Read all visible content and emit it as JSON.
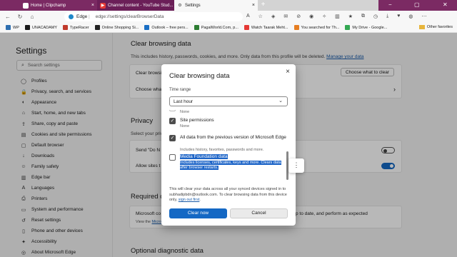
{
  "tabs": [
    {
      "title": "Home | Clipchamp",
      "close": "×"
    },
    {
      "title": "Channel content - YouTube Stud...",
      "close": "×"
    },
    {
      "title": "Settings",
      "close": "×"
    }
  ],
  "new_tab": "+",
  "address": {
    "host": "Edge",
    "separator": "|",
    "path": "edge://settings/clearBrowserData"
  },
  "favorites": [
    {
      "label": "WP",
      "color": "#2f6fb0"
    },
    {
      "label": "UNACADAMY",
      "color": "#1b1b1b"
    },
    {
      "label": "TypeRacer",
      "color": "#c0392b"
    },
    {
      "label": "Online Shopping Si...",
      "color": "#222222"
    },
    {
      "label": "Outlook – free pers...",
      "color": "#1a6fc4"
    },
    {
      "label": "PagalWorld.Com, p...",
      "color": "#2d7d32"
    },
    {
      "label": "Watch Taarak Meht...",
      "color": "#e53935"
    },
    {
      "label": "You searched for Th...",
      "color": "#e67e22"
    },
    {
      "label": "My Drive - Google...",
      "color": "#34a853"
    }
  ],
  "other_favorites": "Other favorites",
  "sidebar": {
    "title": "Settings",
    "search_placeholder": "Search settings",
    "items": [
      {
        "label": "Profiles",
        "icon": "◯"
      },
      {
        "label": "Privacy, search, and services",
        "icon": "🔒"
      },
      {
        "label": "Appearance",
        "icon": "◐"
      },
      {
        "label": "Start, home, and new tabs",
        "icon": "⌂"
      },
      {
        "label": "Share, copy and paste",
        "icon": "⇪"
      },
      {
        "label": "Cookies and site permissions",
        "icon": "▤"
      },
      {
        "label": "Default browser",
        "icon": "▢"
      },
      {
        "label": "Downloads",
        "icon": "↓"
      },
      {
        "label": "Family safety",
        "icon": "☺"
      },
      {
        "label": "Edge bar",
        "icon": "▥"
      },
      {
        "label": "Languages",
        "icon": "A"
      },
      {
        "label": "Printers",
        "icon": "⎙"
      },
      {
        "label": "System and performance",
        "icon": "▭"
      },
      {
        "label": "Reset settings",
        "icon": "↺"
      },
      {
        "label": "Phone and other devices",
        "icon": "▯"
      },
      {
        "label": "Accessibility",
        "icon": "✦"
      },
      {
        "label": "About Microsoft Edge",
        "icon": "◎"
      }
    ]
  },
  "main": {
    "clear_heading": "Clear browsing data",
    "clear_desc": "This includes history, passwords, cookies, and more. Only data from this profile will be deleted.",
    "manage_link": "Manage your data",
    "clear_now_row": "Clear browsi",
    "choose_button": "Choose what to clear",
    "choose_row": "Choose wha",
    "privacy_heading": "Privacy",
    "privacy_desc": "Select your priv",
    "send_row": "Send \"Do N",
    "allow_row": "Allow sites t",
    "required_heading": "Required d",
    "ms_collects": "Microsoft co",
    "ms_collects_tail": "p to date, and perform as expected",
    "view_the": "View the",
    "view_link": "Micro",
    "optional_heading": "Optional diagnostic data"
  },
  "dialog": {
    "title": "Clear browsing data",
    "close": "×",
    "time_range_label": "Time range",
    "time_range_value": "Last hour",
    "options": [
      {
        "title": "",
        "sub": "None",
        "checked": null
      },
      {
        "title": "Site permissions",
        "sub": "None",
        "checked": true
      },
      {
        "title": "All data from the previous version of Microsoft Edge",
        "sub": "Includes history, favorites, passwords and more.",
        "checked": true
      },
      {
        "title": "Media Foundation data",
        "sub": "Includes licenses, certificates, keys and more. Clears data after browser restarts.",
        "checked": false
      }
    ],
    "more": "⋮",
    "sync_note": "This will clear your data across all your synced devices signed in to subhadipbdn@outlook.com. To clear browsing data from this device only,",
    "sign_out_link": "sign out first",
    "clear_now": "Clear now",
    "cancel": "Cancel"
  }
}
